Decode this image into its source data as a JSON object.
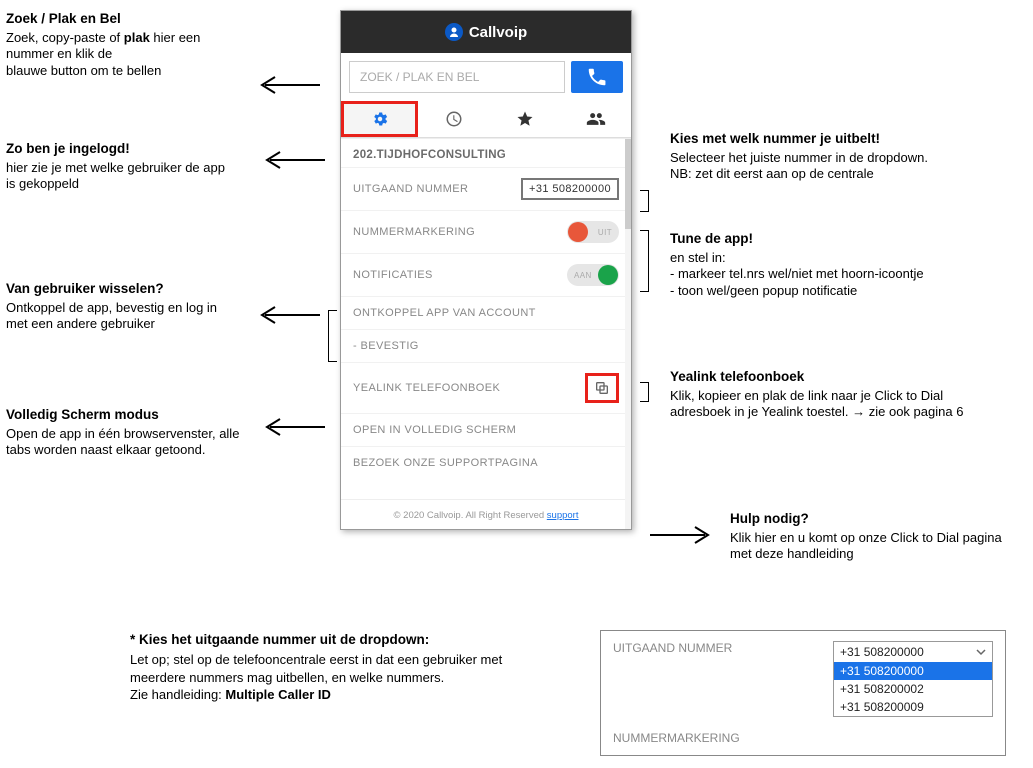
{
  "brand": "Callvoip",
  "search_placeholder": "ZOEK / PLAK EN BEL",
  "account_name": "202.TIJDHOFCONSULTING",
  "rows": {
    "outgoing_label": "UITGAAND NUMMER",
    "outgoing_value": "+31 508200000",
    "marking_label": "NUMMERMARKERING",
    "marking_state": "UIT",
    "notif_label": "NOTIFICATIES",
    "notif_state": "AAN",
    "disconnect": "ONTKOPPEL APP VAN ACCOUNT",
    "confirm": "- BEVESTIG",
    "yealink": "YEALINK TELEFOONBOEK",
    "fullscreen": "OPEN IN VOLLEDIG SCHERM",
    "support": "BEZOEK ONZE SUPPORTPAGINA"
  },
  "footer_text": "© 2020 Callvoip. All Right Reserved ",
  "footer_link": "support",
  "annotations": {
    "a1_title": "Zoek / Plak en Bel",
    "a1_body": "Zoek, copy-paste of plak hier een nummer en klik de\nblauwe button om te bellen",
    "a2_title": "Zo ben je ingelogd!",
    "a2_body": "hier zie je met welke gebruiker de app is gekoppeld",
    "a3_title": "Van gebruiker wisselen?",
    "a3_body": "Ontkoppel de app, bevestig en log in met een andere gebruiker",
    "a4_title": "Volledig Scherm modus",
    "a4_body": "Open de app in één browservenster, alle tabs worden naast elkaar getoond.",
    "a5_title": "Kies met welk nummer je uitbelt!",
    "a5_body": "Selecteer het juiste nummer in de dropdown.\nNB: zet dit eerst aan op de centrale",
    "a6_title": "Tune de app!",
    "a6_body": "en stel in:\n- markeer tel.nrs wel/niet met hoorn-icoontje\n- toon wel/geen popup notificatie",
    "a7_title": "Yealink telefoonboek",
    "a7_body": "Klik, kopieer en plak de link naar je Click to Dial adresboek in je Yealink toestel. → zie ook pagina 6",
    "a8_title": "Hulp nodig?",
    "a8_body": "Klik hier en u komt op onze Click to Dial pagina met deze handleiding"
  },
  "bottom": {
    "title": "* Kies het uitgaande nummer uit de dropdown:",
    "body": "Let op; stel op de telefooncentrale eerst in dat een gebruiker met meerdere nummers mag uitbellen, en welke nummers.\nZie handleiding: ",
    "link": "Multiple Caller ID"
  },
  "detail": {
    "label1": "UITGAAND NUMMER",
    "label2": "NUMMERMARKERING",
    "selected": "+31 508200000",
    "options": [
      "+31 508200000",
      "+31 508200002",
      "+31 508200009"
    ]
  }
}
